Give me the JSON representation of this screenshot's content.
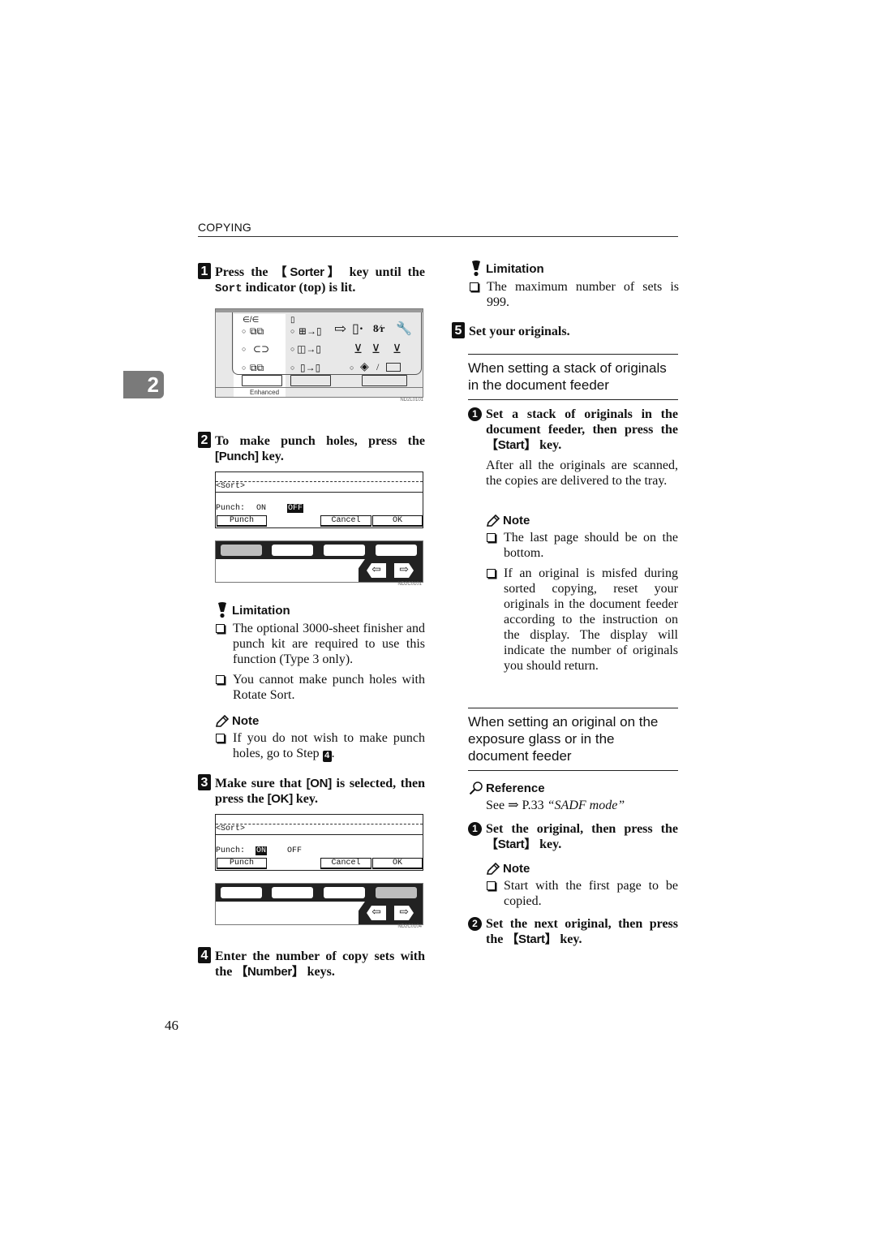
{
  "header": {
    "running_head": "COPYING"
  },
  "chapter_tab": "2",
  "page_number": "46",
  "left_column": {
    "step1": {
      "number": "1",
      "text_pre": "Press the ",
      "key": "【Sorter】",
      "text_mid": " key until the ",
      "indicator": "Sort",
      "text_post": " indicator (top) is lit.",
      "figure": {
        "top_left_icon": "∈/∈",
        "enhanced_label": "Enhanced",
        "code": "ND2L0101"
      }
    },
    "step2": {
      "number": "2",
      "text_pre": "To make punch holes, press the ",
      "key": "[Punch]",
      "text_post": " key.",
      "figure": {
        "lcd_title": "<Sort>",
        "punch_label": "Punch:",
        "on_label": "ON",
        "off_label": "OFF",
        "selected": "OFF",
        "buttons": [
          "Punch",
          "Cancel",
          "OK"
        ],
        "code": "ND2C0101"
      }
    },
    "limitation": {
      "title": "Limitation",
      "items": [
        "The optional 3000-sheet finisher and punch kit are required to use this function (Type 3 only).",
        "You cannot make punch holes with Rotate Sort."
      ]
    },
    "note": {
      "title": "Note",
      "item_pre": "If you do not wish to make punch holes, go to Step ",
      "step_ref": "4",
      "item_post": "."
    },
    "step3": {
      "number": "3",
      "text_pre": "Make sure that ",
      "key1": "[ON]",
      "text_mid": " is selected, then press the ",
      "key2": "[OK]",
      "text_post": " key.",
      "figure": {
        "lcd_title": "<Sort>",
        "punch_label": "Punch:",
        "on_label": "ON",
        "off_label": "OFF",
        "selected": "ON",
        "buttons": [
          "Punch",
          "Cancel",
          "OK"
        ],
        "code": "ND2C0104"
      }
    },
    "step4": {
      "number": "4",
      "text_pre": "Enter the number of copy sets with the ",
      "key": "【Number】",
      "text_post": " keys."
    }
  },
  "right_column": {
    "limitation": {
      "title": "Limitation",
      "items": [
        "The maximum number of sets is 999."
      ]
    },
    "step5": {
      "number": "5",
      "text": "Set your originals."
    },
    "section1": {
      "title": "When setting a stack of originals in the document feeder",
      "sub1": {
        "number": "1",
        "text_pre": "Set a stack of originals in the document feeder, then press the ",
        "key": "【Start】",
        "text_post": " key.",
        "body": "After all the originals are scanned, the copies are delivered to the tray."
      },
      "note": {
        "title": "Note",
        "items": [
          "The last page should be on the bottom.",
          "If an original is misfed during sorted copying, reset your originals in the document feeder according to the instruction on the display. The display will indicate the number of originals you should return."
        ]
      }
    },
    "section2": {
      "title": "When setting an original on the exposure glass or in the document feeder",
      "reference": {
        "title": "Reference",
        "text_pre": "See ⇒ P.33 ",
        "link": "“SADF mode”"
      },
      "sub1": {
        "number": "1",
        "text_pre": "Set the original, then press the ",
        "key": "【Start】",
        "text_post": " key."
      },
      "note": {
        "title": "Note",
        "items": [
          "Start with the first page to be copied."
        ]
      },
      "sub2": {
        "number": "2",
        "text_pre": "Set the next original, then press the ",
        "key": "【Start】",
        "text_post": " key."
      }
    }
  }
}
